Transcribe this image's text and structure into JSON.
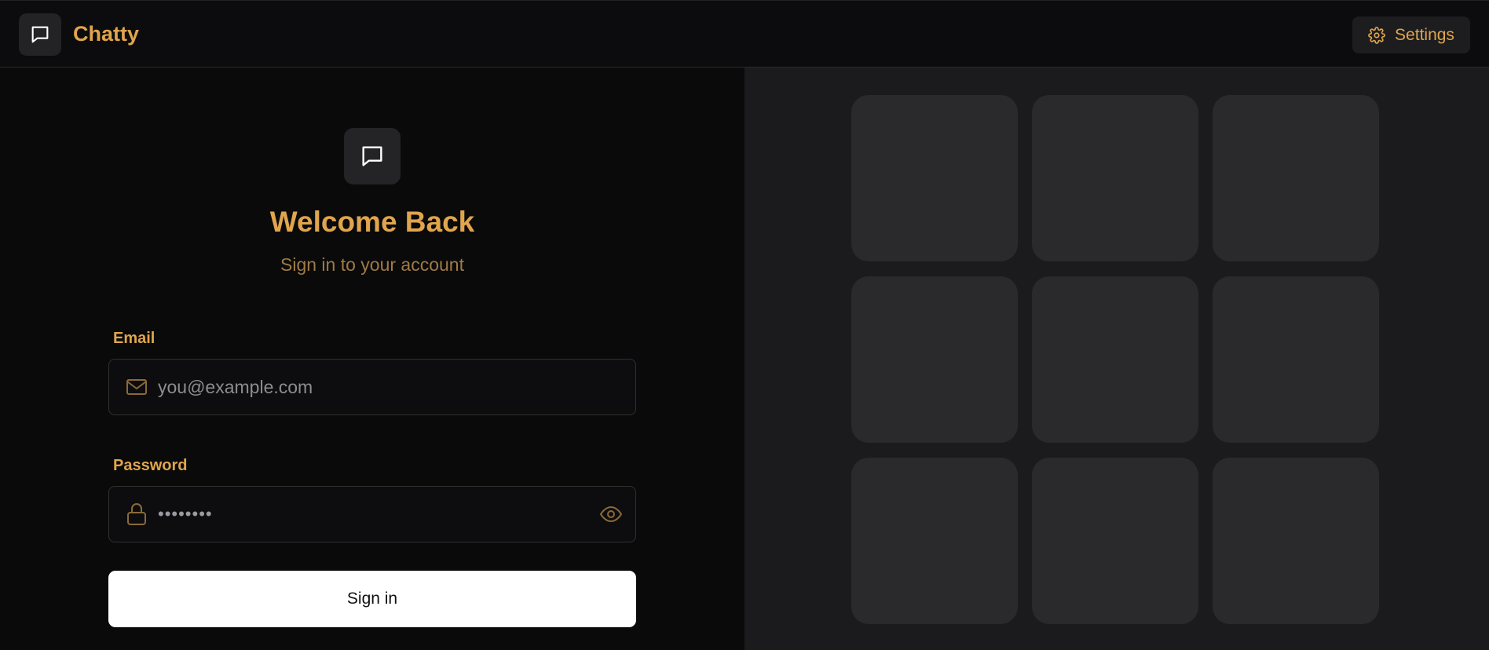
{
  "app": {
    "name": "Chatty"
  },
  "header": {
    "settings_label": "Settings"
  },
  "login": {
    "title": "Welcome Back",
    "subtitle": "Sign in to your account",
    "email_label": "Email",
    "email_placeholder": "you@example.com",
    "password_label": "Password",
    "password_value": "••••••••",
    "submit_label": "Sign in"
  },
  "icons": {
    "brand": "chat-bubble-icon",
    "settings": "gear-icon",
    "email": "mail-icon",
    "password": "lock-icon",
    "toggle_visibility": "eye-icon"
  },
  "colors": {
    "accent": "#e0a54d",
    "muted_accent": "#a07a45",
    "background": "#0a0a0b",
    "panel": "#1b1b1d",
    "tile": "#2a2a2d",
    "button": "#ffffff"
  },
  "pattern": {
    "tile_count": 9
  }
}
